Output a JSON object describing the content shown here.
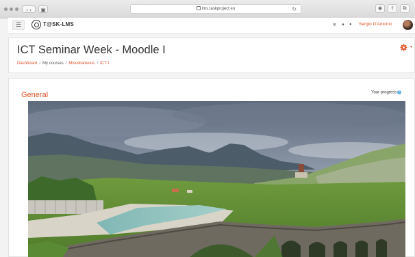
{
  "browser": {
    "url": "lms.taskproject.eu"
  },
  "topnav": {
    "menu_icon": "hamburger-icon",
    "brand": "T@SK-LMS",
    "icons": [
      "messages-icon",
      "notifications-icon",
      "chat-icon"
    ],
    "user_name": "Sergio D'Antonio"
  },
  "header": {
    "title": "ICT Seminar Week - Moodle I",
    "breadcrumbs": [
      "Dashboard",
      "My courses",
      "Miscellaneous",
      "ICT-I"
    ]
  },
  "section": {
    "title": "General",
    "progress_label": "Your progress",
    "help_symbol": "?"
  },
  "colors": {
    "accent": "#e2532b",
    "info": "#5ab1e0"
  }
}
